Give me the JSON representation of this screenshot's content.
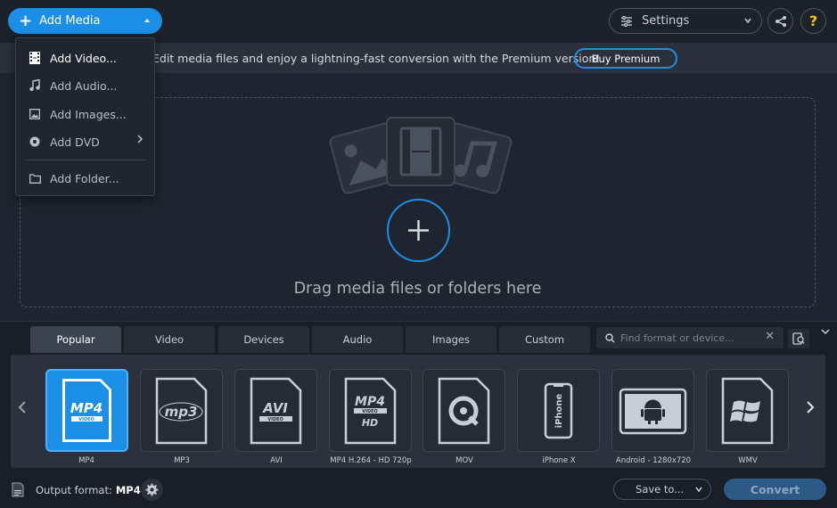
{
  "header": {
    "add_media_label": "Add Media",
    "settings_label": "Settings"
  },
  "menu": {
    "items": [
      {
        "label": "Add Video..."
      },
      {
        "label": "Add Audio..."
      },
      {
        "label": "Add Images..."
      },
      {
        "label": "Add DVD"
      },
      {
        "label": "Add Folder..."
      }
    ]
  },
  "banner": {
    "text": "Edit media files and enjoy a lightning-fast conversion with the Premium version!",
    "buy_label": "Buy Premium"
  },
  "dropzone": {
    "text": "Drag media files or folders here"
  },
  "tabs": [
    {
      "label": "Popular"
    },
    {
      "label": "Video"
    },
    {
      "label": "Devices"
    },
    {
      "label": "Audio"
    },
    {
      "label": "Images"
    },
    {
      "label": "Custom"
    }
  ],
  "search": {
    "placeholder": "Find format or device..."
  },
  "formats": [
    {
      "label": "MP4",
      "icon_text": "MP4",
      "icon_sub": "VIDEO"
    },
    {
      "label": "MP3",
      "icon_text": "mp3"
    },
    {
      "label": "AVI",
      "icon_text": "AVI",
      "icon_sub": "VIDEO"
    },
    {
      "label": "MP4 H.264 - HD 720p",
      "icon_text": "MP4",
      "icon_sub": "VIDEO",
      "icon_hd": "HD"
    },
    {
      "label": "MOV"
    },
    {
      "label": "iPhone X",
      "icon_text": "iPhone"
    },
    {
      "label": "Android - 1280x720"
    },
    {
      "label": "WMV"
    }
  ],
  "footer": {
    "output_label": "Output format:",
    "output_value": "MP4",
    "save_label": "Save to...",
    "convert_label": "Convert"
  },
  "colors": {
    "accent": "#1b8fe6",
    "background": "#1f2530"
  }
}
